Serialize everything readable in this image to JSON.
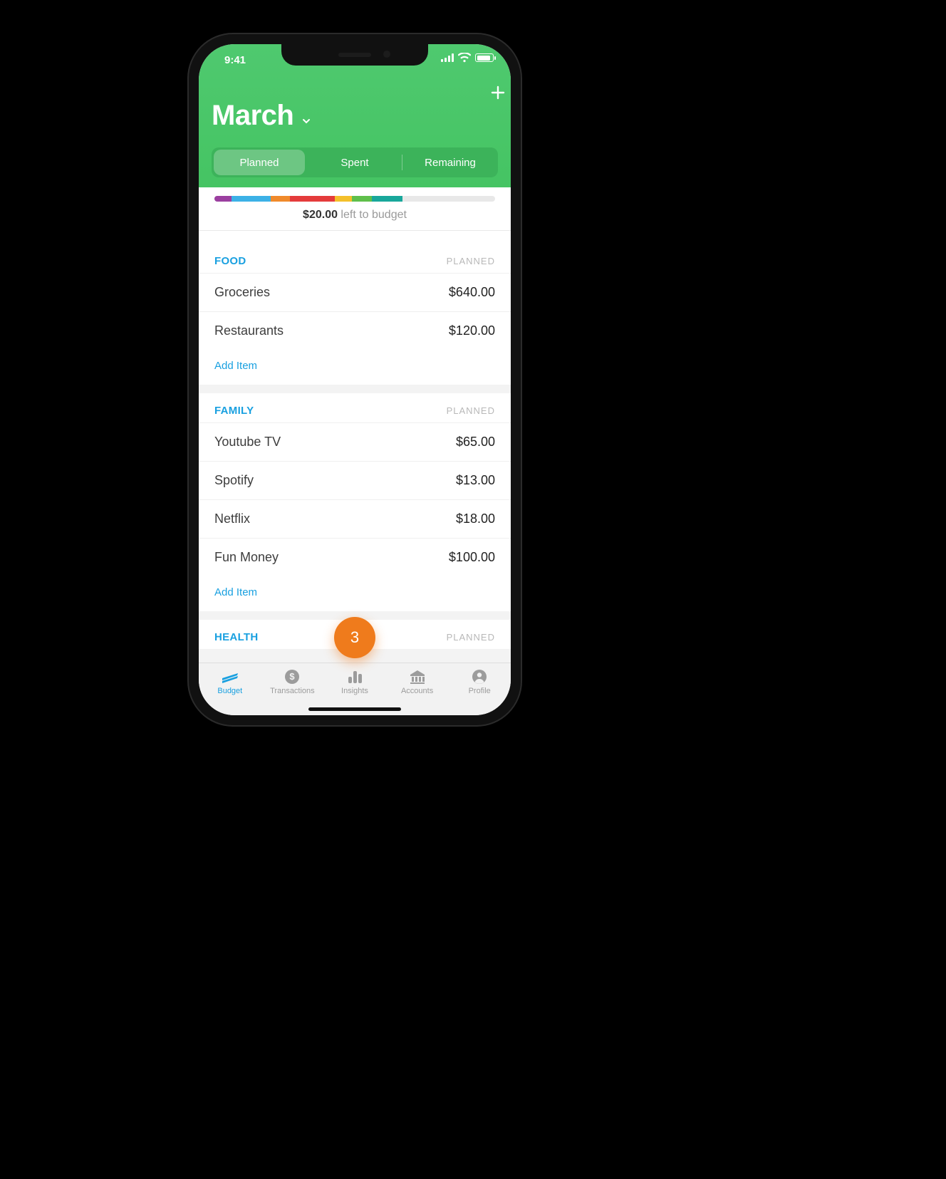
{
  "status": {
    "time": "9:41"
  },
  "header": {
    "month": "March",
    "tabs": {
      "planned": "Planned",
      "spent": "Spent",
      "remaining": "Remaining"
    }
  },
  "remaining": {
    "amount": "$20.00",
    "suffix": " left to budget",
    "segments": [
      {
        "color": "#9b3fa0",
        "pct": 6
      },
      {
        "color": "#3cb1e6",
        "pct": 14
      },
      {
        "color": "#f08a2b",
        "pct": 7
      },
      {
        "color": "#e43b3b",
        "pct": 16
      },
      {
        "color": "#f4c02b",
        "pct": 6
      },
      {
        "color": "#5fbf4b",
        "pct": 7
      },
      {
        "color": "#18a79b",
        "pct": 11
      }
    ]
  },
  "column_label": "PLANNED",
  "add_item_label": "Add Item",
  "categories": [
    {
      "name": "FOOD",
      "items": [
        {
          "label": "Groceries",
          "amount": "$640.00"
        },
        {
          "label": "Restaurants",
          "amount": "$120.00"
        }
      ]
    },
    {
      "name": "FAMILY",
      "items": [
        {
          "label": "Youtube TV",
          "amount": "$65.00"
        },
        {
          "label": "Spotify",
          "amount": "$13.00"
        },
        {
          "label": "Netflix",
          "amount": "$18.00"
        },
        {
          "label": "Fun Money",
          "amount": "$100.00"
        }
      ]
    },
    {
      "name": "HEALTH",
      "items": []
    }
  ],
  "fab": {
    "count": "3"
  },
  "tabs": {
    "budget": "Budget",
    "transactions": "Transactions",
    "insights": "Insights",
    "accounts": "Accounts",
    "profile": "Profile"
  }
}
